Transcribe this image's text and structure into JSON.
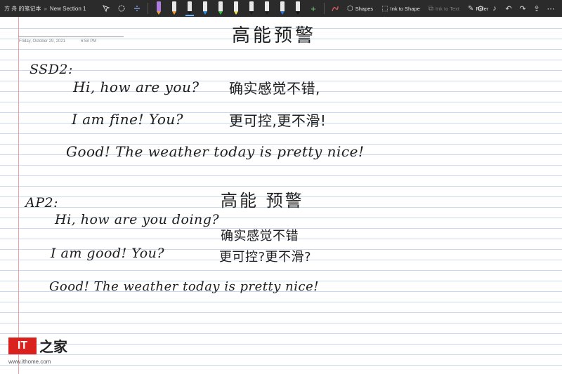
{
  "breadcrumb": {
    "notebook": "方 舟 的笔记本",
    "separator": "»",
    "section": "New Section 1"
  },
  "toolbar": {
    "tools": [
      {
        "icon": "lasso-select-icon"
      },
      {
        "icon": "add-space-icon"
      },
      {
        "icon": "insert-space-icon"
      }
    ],
    "pens": [
      {
        "icon": "eraser-icon",
        "color": "#b07be0"
      },
      {
        "icon": "pen-icon",
        "color": "#f0a030"
      },
      {
        "icon": "pen-icon",
        "color": "#1a1a1a"
      },
      {
        "icon": "pen-icon",
        "color": "#2e8fe0"
      },
      {
        "icon": "pen-icon",
        "color": "#3fbf3f"
      },
      {
        "icon": "highlighter-icon",
        "color": "#f2e94e"
      },
      {
        "icon": "pen-icon",
        "color": "#1a1a1a"
      },
      {
        "icon": "pen-icon",
        "color": "#1a1a1a"
      },
      {
        "icon": "pen-icon",
        "color": "#2f6fd8"
      },
      {
        "icon": "pen-icon",
        "color": "#111111"
      }
    ],
    "add_pen_icon": "plus-icon",
    "ink_replay_icon": "ink-replay-icon",
    "shapes_label": "Shapes",
    "ink_to_shape_label": "Ink to Shape",
    "ink_to_text_label": "Ink to Text",
    "ruler_label": "Ruler",
    "right_icons": [
      "ink-settings-icon",
      "notifications-icon",
      "undo-icon",
      "redo-icon",
      "share-icon",
      "more-icon"
    ]
  },
  "page": {
    "date": "Friday, October 29, 2021",
    "time": "6:58 PM"
  },
  "note": {
    "title": "高能预警",
    "ssd_label": "SSD2:",
    "ssd_line1_en": "Hi, how are you?",
    "ssd_line1_cn": "确实感觉不错,",
    "ssd_line2_en": "I am fine! You?",
    "ssd_line2_cn": "更可控,更不滑!",
    "ssd_line3": "Good! The weather today is pretty nice!",
    "ap_label": "AP2:",
    "ap_title": "高能 预警",
    "ap_line1_en": "Hi, how are you doing?",
    "ap_line1_cn": "确实感觉不错",
    "ap_line2_en": "I am good! You?",
    "ap_line2_cn": "更可控?更不滑?",
    "ap_line3": "Good! The weather today is pretty nice!"
  },
  "watermark": {
    "logo_latin": "IT",
    "logo_cn": "之家",
    "url": "www.ithome.com"
  }
}
